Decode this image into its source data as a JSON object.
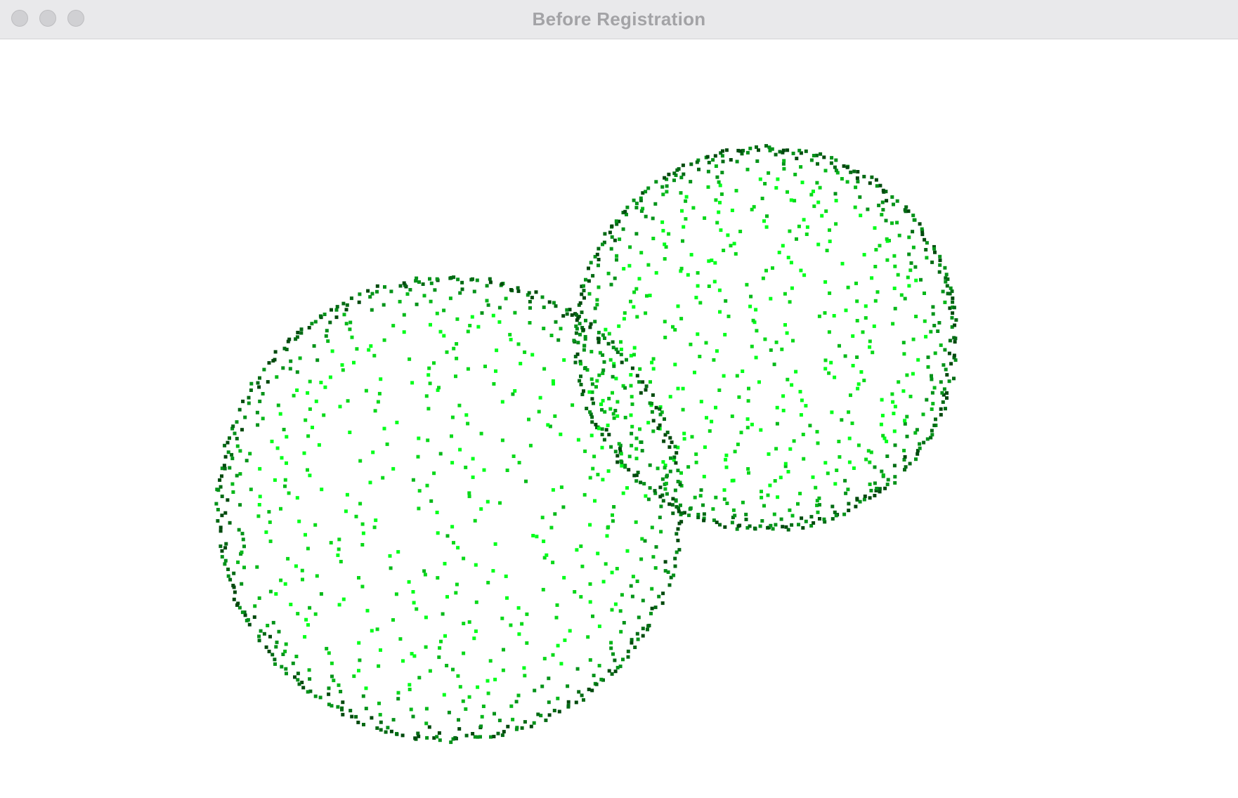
{
  "window": {
    "title": "Before Registration",
    "buttons": {
      "close": "close-icon",
      "minimize": "minimize-icon",
      "zoom": "zoom-icon"
    }
  },
  "scene": {
    "background_color": "#ffffff",
    "point_colors": [
      "#00ff1a",
      "#0ad81a",
      "#07b81a",
      "#05931a",
      "#036b14",
      "#024a0e"
    ],
    "clouds": [
      {
        "name": "source-point-cloud",
        "shape": "sphere",
        "point_count": 1500
      },
      {
        "name": "target-point-cloud",
        "shape": "sphere",
        "point_count": 1500
      }
    ]
  }
}
